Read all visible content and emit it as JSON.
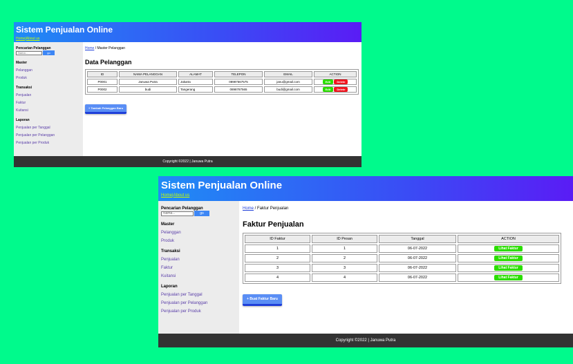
{
  "screenshot1": {
    "header": {
      "title": "Sistem Penjualan Online",
      "nav": [
        "Home",
        "About us"
      ]
    },
    "sidebar": {
      "search_label": "Pencarian Pelanggan",
      "search_placeholder": "Nama...",
      "go_label": "go",
      "groups": [
        {
          "title": "Master",
          "items": [
            "Pelanggan",
            "Produk"
          ]
        },
        {
          "title": "Transaksi",
          "items": [
            "Penjualan",
            "Faktur",
            "Kuitansi"
          ]
        },
        {
          "title": "Laporan",
          "items": [
            "Penjualan per Tanggal",
            "Penjualan per Pelanggan",
            "Penjualan per Produk"
          ]
        }
      ]
    },
    "breadcrumb": {
      "home": "Home",
      "current": " / Master Pelanggan"
    },
    "page_title": "Data Pelanggan",
    "table": {
      "headers": [
        "ID",
        "NAMA PELANGGAN",
        "ALAMAT",
        "TELEPON",
        "EMAIL",
        "ACTION"
      ],
      "rows": [
        [
          "P0001",
          "Januwa Putra",
          "Jakarta",
          "08987567575",
          "janu@gmail.com"
        ],
        [
          "P0002",
          "budi",
          "Tangerang",
          "0898787565",
          "budi@gmail.com"
        ]
      ],
      "edit_label": "Edit",
      "delete_label": "Delete"
    },
    "add_button": "+ Tambah Pelanggan Baru",
    "footer": "Copyright ©2022 | Januwa Putra"
  },
  "screenshot2": {
    "header": {
      "title": "Sistem Penjualan Online",
      "nav": [
        "Home",
        "About us"
      ]
    },
    "sidebar": {
      "search_label": "Pencarian Pelanggan",
      "search_placeholder": "Nama...",
      "go_label": "go",
      "groups": [
        {
          "title": "Master",
          "items": [
            "Pelanggan",
            "Produk"
          ]
        },
        {
          "title": "Transaksi",
          "items": [
            "Penjualan",
            "Faktur",
            "Kuitansi"
          ]
        },
        {
          "title": "Laporan",
          "items": [
            "Penjualan per Tanggal",
            "Penjualan per Pelanggan",
            "Penjualan per Produk"
          ]
        }
      ]
    },
    "breadcrumb": {
      "home": "Home",
      "current": " / Faktur Penjualan"
    },
    "page_title": "Faktur Penjualan",
    "table": {
      "headers": [
        "ID Faktur",
        "ID Pesan",
        "Tanggal",
        "ACTION"
      ],
      "rows": [
        [
          "1",
          "1",
          "06-07-2022"
        ],
        [
          "2",
          "2",
          "06-07-2022"
        ],
        [
          "3",
          "3",
          "06-07-2022"
        ],
        [
          "4",
          "4",
          "06-07-2022"
        ]
      ],
      "action_label": "Lihat Faktur"
    },
    "add_button": "+ Buat Faktur Baru",
    "footer": "Copyright ©2022 | Januwa Putra"
  }
}
